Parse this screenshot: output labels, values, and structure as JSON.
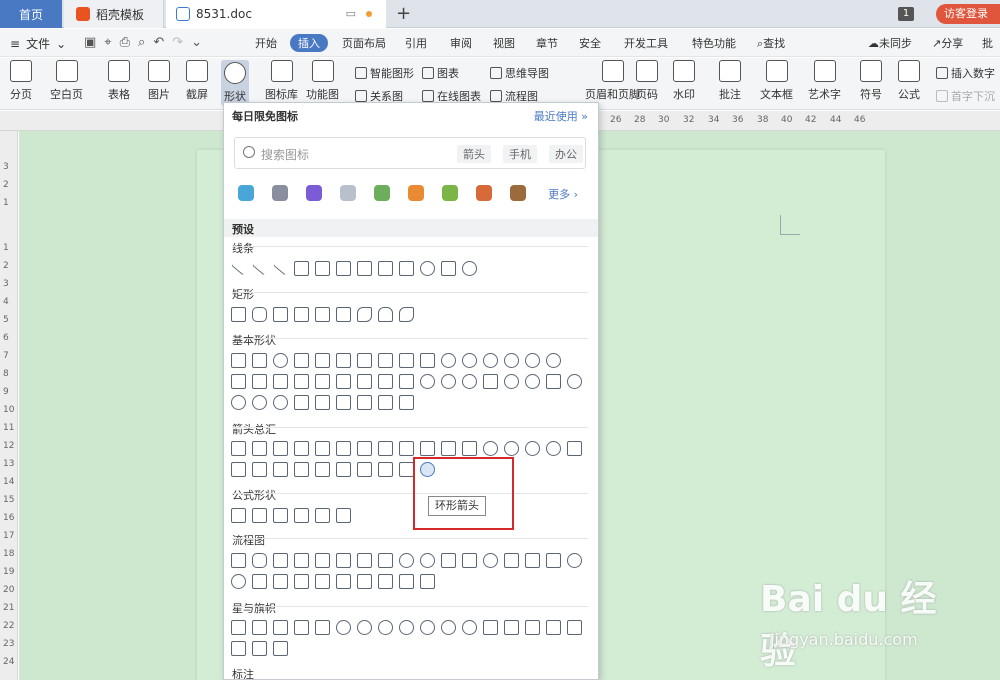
{
  "titlebar": {
    "tabs": [
      {
        "label": "首页"
      },
      {
        "label": "稻壳模板"
      },
      {
        "label": "8531.doc"
      }
    ],
    "badge": "1",
    "login": "访客登录"
  },
  "menubar": {
    "file": "文件",
    "tabs": [
      "开始",
      "插入",
      "页面布局",
      "引用",
      "审阅",
      "视图",
      "章节",
      "安全",
      "开发工具",
      "特色功能"
    ],
    "active_tab": "插入",
    "search": "查找",
    "sync": "未同步",
    "share": "分享",
    "comment": "批"
  },
  "ribbon": {
    "buttons": [
      "分页",
      "空白页",
      "表格",
      "图片",
      "截屏",
      "形状",
      "图标库",
      "功能图",
      "页眉和页脚",
      "页码",
      "水印",
      "批注",
      "文本框",
      "艺术字",
      "符号",
      "公式"
    ],
    "small": [
      "智能图形",
      "图表",
      "思维导图",
      "关系图",
      "在线图表",
      "流程图",
      "插入数字",
      "首字下沉"
    ]
  },
  "ruler": {
    "h": [
      "26",
      "28",
      "30",
      "32",
      "34",
      "36",
      "38",
      "40",
      "42",
      "44",
      "46"
    ],
    "v": [
      "3",
      "2",
      "1",
      "1",
      "2",
      "3",
      "4",
      "5",
      "6",
      "7",
      "8",
      "9",
      "10",
      "11",
      "12",
      "13",
      "14",
      "15",
      "16",
      "17",
      "18",
      "19",
      "20",
      "21",
      "22",
      "23",
      "24"
    ]
  },
  "panel": {
    "title": "每日限免图标",
    "recent": "最近使用",
    "search_placeholder": "搜索图标",
    "chips": [
      "箭头",
      "手机",
      "办公"
    ],
    "more": "更多",
    "preset": "预设",
    "categories": [
      "线条",
      "矩形",
      "基本形状",
      "箭头总汇",
      "公式形状",
      "流程图",
      "星与旗帜",
      "标注"
    ]
  },
  "tooltip": "环形箭头",
  "watermark": {
    "logo": "Bai du 经验",
    "url": "jingyan.baidu.com"
  }
}
